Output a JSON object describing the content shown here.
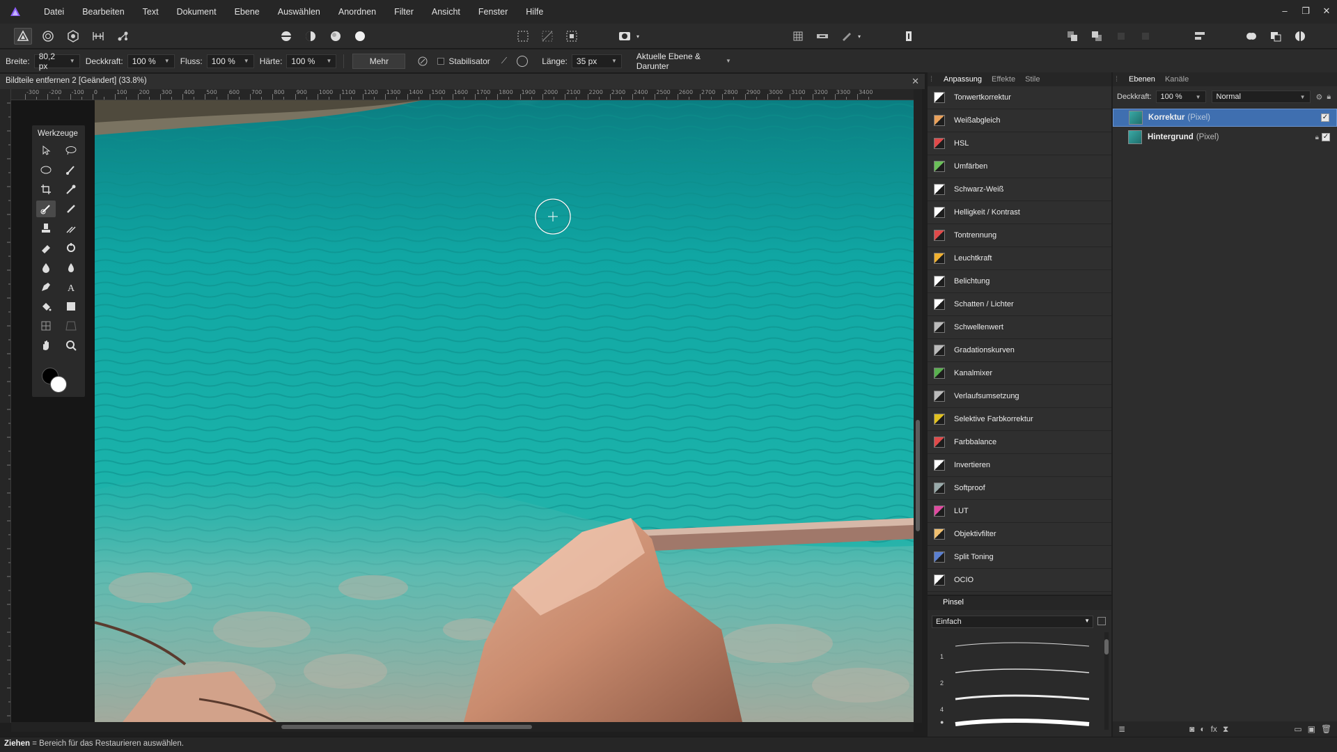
{
  "menu": {
    "items": [
      "Datei",
      "Bearbeiten",
      "Text",
      "Dokument",
      "Ebene",
      "Auswählen",
      "Anordnen",
      "Filter",
      "Ansicht",
      "Fenster",
      "Hilfe"
    ],
    "logo_icon": "affinity-photo-logo"
  },
  "window_controls": [
    "–",
    "❐",
    "✕"
  ],
  "context": {
    "width_label": "Breite:",
    "width_value": "80,2 px",
    "opacity_label": "Deckkraft:",
    "opacity_value": "100 %",
    "flow_label": "Fluss:",
    "flow_value": "100 %",
    "hardness_label": "Härte:",
    "hardness_value": "100 %",
    "more_label": "Mehr",
    "stabilizer_label": "Stabilisator",
    "length_label": "Länge:",
    "length_value": "35 px",
    "sample_value": "Aktuelle Ebene & Darunter"
  },
  "document": {
    "title": "Bildteile entfernen 2 [Geändert] (33.8%)",
    "close": "✕"
  },
  "ruler_labels": [
    "-300",
    "-200",
    "-100",
    "0",
    "100",
    "200",
    "300",
    "400",
    "500",
    "600",
    "700",
    "800",
    "900",
    "1000",
    "1100",
    "1200",
    "1300",
    "1400",
    "1500",
    "1600",
    "1700",
    "1800",
    "1900",
    "2000",
    "2100",
    "2200",
    "2300",
    "2400",
    "2500",
    "2600",
    "2700",
    "2800",
    "2900",
    "3000",
    "3100",
    "3200",
    "3300",
    "3400"
  ],
  "tools": {
    "title": "Werkzeuge"
  },
  "adjustments": {
    "tabs": [
      "Anpassung",
      "Effekte",
      "Stile"
    ],
    "items": [
      {
        "label": "Tonwertkorrektur",
        "icon": "levels-icon"
      },
      {
        "label": "Weißabgleich",
        "icon": "white-balance-icon"
      },
      {
        "label": "HSL",
        "icon": "hsl-icon"
      },
      {
        "label": "Umfärben",
        "icon": "recolor-icon"
      },
      {
        "label": "Schwarz-Weiß",
        "icon": "black-white-icon"
      },
      {
        "label": "Helligkeit / Kontrast",
        "icon": "brightness-contrast-icon"
      },
      {
        "label": "Tontrennung",
        "icon": "posterize-icon"
      },
      {
        "label": "Leuchtkraft",
        "icon": "vibrance-icon"
      },
      {
        "label": "Belichtung",
        "icon": "exposure-icon"
      },
      {
        "label": "Schatten / Lichter",
        "icon": "shadows-highlights-icon"
      },
      {
        "label": "Schwellenwert",
        "icon": "threshold-icon"
      },
      {
        "label": "Gradationskurven",
        "icon": "curves-icon"
      },
      {
        "label": "Kanalmixer",
        "icon": "channel-mixer-icon"
      },
      {
        "label": "Verlaufsumsetzung",
        "icon": "gradient-map-icon"
      },
      {
        "label": "Selektive Farbkorrektur",
        "icon": "selective-color-icon"
      },
      {
        "label": "Farbbalance",
        "icon": "color-balance-icon"
      },
      {
        "label": "Invertieren",
        "icon": "invert-icon"
      },
      {
        "label": "Softproof",
        "icon": "soft-proof-icon"
      },
      {
        "label": "LUT",
        "icon": "lut-icon"
      },
      {
        "label": "Objektivfilter",
        "icon": "lens-filter-icon"
      },
      {
        "label": "Split Toning",
        "icon": "split-toning-icon"
      },
      {
        "label": "OCIO",
        "icon": "ocio-icon"
      }
    ]
  },
  "brush": {
    "title": "Pinsel",
    "category": "Einfach",
    "sizes": [
      "1",
      "2",
      "4",
      "●"
    ]
  },
  "layers": {
    "tabs": [
      "Ebenen",
      "Kanäle"
    ],
    "opacity_label": "Deckkraft:",
    "opacity_value": "100 %",
    "blend_mode": "Normal",
    "items": [
      {
        "name": "Korrektur",
        "type": "(Pixel)",
        "selected": true
      },
      {
        "name": "Hintergrund",
        "type": "(Pixel)",
        "selected": false
      }
    ]
  },
  "status": {
    "action": "Ziehen",
    "text": " = Bereich für das Restaurieren auswählen."
  },
  "colors": {
    "accent": "#3f6fb0",
    "water": "#1aa39e",
    "rock": "#c98b6e"
  }
}
